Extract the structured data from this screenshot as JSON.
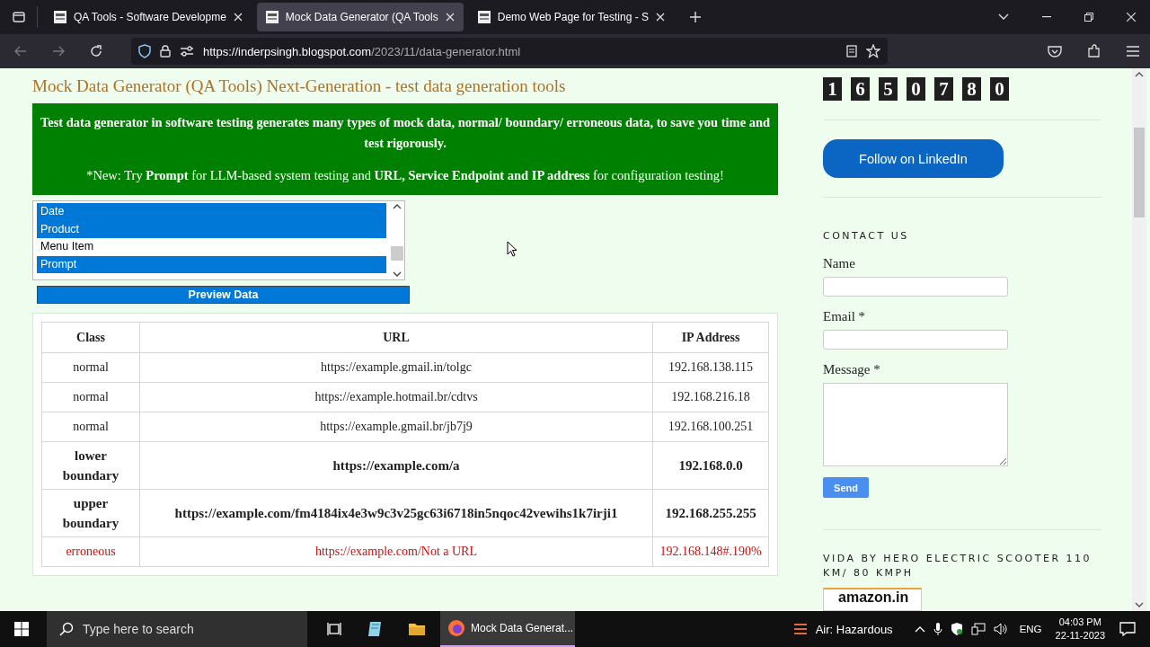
{
  "browser": {
    "tabs": [
      {
        "title": "QA Tools - Software Developme",
        "selected": false
      },
      {
        "title": "Mock Data Generator (QA Tools",
        "selected": true
      },
      {
        "title": "Demo Web Page for Testing - S",
        "selected": false
      }
    ],
    "url_domain": "https://inderpsingh.blogspot.com",
    "url_path": "/2023/11/data-generator.html"
  },
  "page": {
    "title": "Mock Data Generator (QA Tools) Next-Generation - test data generation tools",
    "banner": [
      "Test data generator in software testing generates many types of mock data, normal/ boundary/ erroneous data, to save you time and test rigorously.",
      "*New: Try **Prompt** for LLM-based system testing and **URL, Service Endpoint and IP address** for configuration testing!"
    ],
    "data_types": [
      {
        "label": "Date",
        "selected": true
      },
      {
        "label": "Product",
        "selected": true
      },
      {
        "label": "Menu Item",
        "selected": false
      },
      {
        "label": "Prompt",
        "selected": true
      }
    ],
    "preview_button": "Preview Data",
    "table": {
      "columns": [
        "Class",
        "URL",
        "IP Address"
      ],
      "rows": [
        {
          "kind": "normal",
          "cells": [
            "normal",
            "https://example.gmail.in/tolgc",
            "192.168.138.115"
          ]
        },
        {
          "kind": "normal",
          "cells": [
            "normal",
            "https://example.hotmail.br/cdtvs",
            "192.168.216.18"
          ]
        },
        {
          "kind": "normal",
          "cells": [
            "normal",
            "https://example.gmail.br/jb7j9",
            "192.168.100.251"
          ]
        },
        {
          "kind": "boundary",
          "cells": [
            "lower boundary",
            "https://example.com/a",
            "192.168.0.0"
          ]
        },
        {
          "kind": "boundary",
          "cells": [
            "upper boundary",
            "https://example.com/fm4184ix4e3w9c3v25gc63i6718in5nqoc42vewihs1k7irji1",
            "192.168.255.255"
          ]
        },
        {
          "kind": "erroneous",
          "cells": [
            "erroneous",
            "https://example.com/Not a URL",
            "192.168.148#.190%"
          ]
        }
      ]
    }
  },
  "sidebar": {
    "counter": [
      "1",
      "6",
      "5",
      "0",
      "7",
      "8",
      "0"
    ],
    "linkedin_button": "Follow on LinkedIn",
    "contact_heading": "CONTACT US",
    "fields": [
      {
        "label": "Name",
        "kind": "input"
      },
      {
        "label": "Email *",
        "kind": "input"
      },
      {
        "label": "Message *",
        "kind": "textarea"
      }
    ],
    "send_button": "Send",
    "ad_heading": "VIDA BY HERO ELECTRIC SCOOTER 110 KM/ 80 KMPH",
    "ad_logo": "amazon.in"
  },
  "taskbar": {
    "search_placeholder": "Type here to search",
    "app": "Mock Data Generat...",
    "weather": "Air: Hazardous",
    "language": "ENG",
    "time": "04:03 PM",
    "date": "22-11-2023"
  }
}
